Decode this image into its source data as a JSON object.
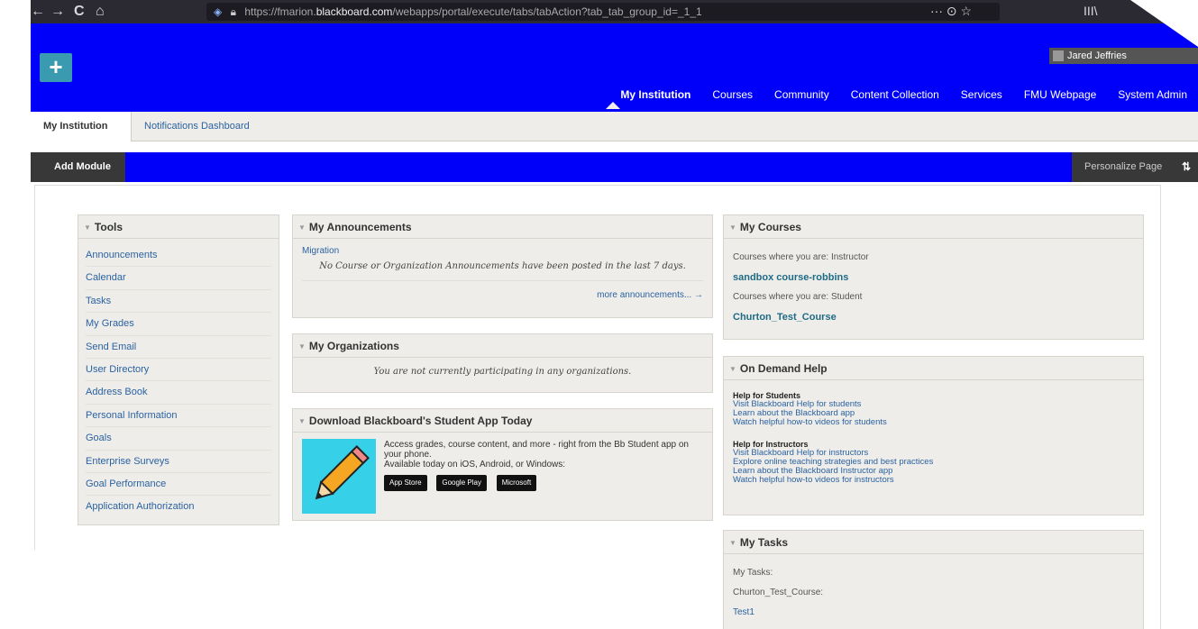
{
  "browser": {
    "url_prefix": "https://fmarion.",
    "url_domain": "blackboard.com",
    "url_rest": "/webapps/portal/execute/tabs/tabAction?tab_tab_group_id=_1_1",
    "back": "←",
    "forward": "→",
    "reload": "C",
    "home": "⌂",
    "page_actions": "··· ⊙ ☆",
    "library": "III\\"
  },
  "header": {
    "plus": "+",
    "user_name": "Jared Jeffries",
    "nav": [
      "My Institution",
      "Courses",
      "Community",
      "Content Collection",
      "Services",
      "FMU Webpage",
      "System Admin"
    ]
  },
  "subtabs": {
    "active": "My Institution",
    "other": "Notifications Dashboard"
  },
  "modulebar": {
    "add_module": "Add Module",
    "personalize": "Personalize Page",
    "sort": "⇅"
  },
  "tools": {
    "title": "Tools",
    "items": [
      "Announcements",
      "Calendar",
      "Tasks",
      "My Grades",
      "Send Email",
      "User Directory",
      "Address Book",
      "Personal Information",
      "Goals",
      "Enterprise Surveys",
      "Goal Performance",
      "Application Authorization"
    ]
  },
  "announcements": {
    "title": "My Announcements",
    "link": "Migration",
    "message": "No Course or Organization Announcements have been posted in the last 7 days.",
    "more": "more announcements..."
  },
  "organizations": {
    "title": "My Organizations",
    "message": "You are not currently participating in any organizations."
  },
  "app": {
    "title": "Download Blackboard's Student App Today",
    "line1": "Access grades, course content, and more - right from the Bb Student app on your phone.",
    "line2": "Available today on iOS, Android, or Windows:",
    "badges": [
      "App Store",
      "Google Play",
      "Microsoft"
    ]
  },
  "courses": {
    "title": "My Courses",
    "instructor_label": "Courses where you are: Instructor",
    "instructor_course": "sandbox course-robbins",
    "student_label": "Courses where you are: Student",
    "student_course": "Churton_Test_Course"
  },
  "help": {
    "title": "On Demand Help",
    "students_head": "Help for Students",
    "students_links": [
      "Visit Blackboard Help for students",
      "Learn about the Blackboard app",
      "Watch helpful how-to videos for students"
    ],
    "instructors_head": "Help for Instructors",
    "instructors_links": [
      "Visit Blackboard Help for instructors",
      "Explore online teaching strategies and best practices",
      "Learn about the Blackboard Instructor app",
      "Watch helpful how-to videos for instructors"
    ]
  },
  "tasks": {
    "title": "My Tasks",
    "label": "My Tasks:",
    "course": "Churton_Test_Course:",
    "item": "Test1"
  }
}
